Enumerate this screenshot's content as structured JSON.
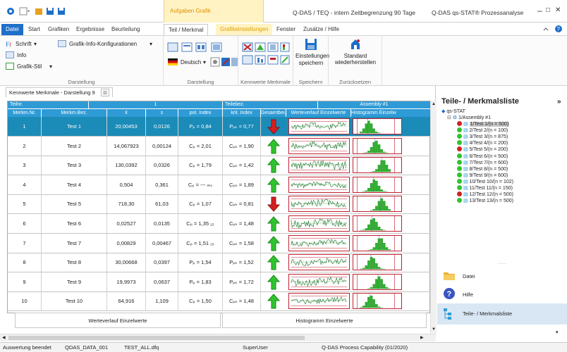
{
  "titlebar": {
    "context_label": "Aufgaben Grafik",
    "title_left": "Q-DAS / TEQ - intern Zeitbegrenzung 90 Tage",
    "title_right": "Q-DAS qs-STAT® Prozessanalyse",
    "min": "–",
    "max": "□",
    "close": "✕"
  },
  "tabs": [
    "Datei",
    "Start",
    "Grafiken",
    "Ergebnisse",
    "Beurteilung",
    "Teil / Merkmal",
    "Grafikeinstellungen",
    "Fenster",
    "Zusätze / Hilfe"
  ],
  "ribbon": {
    "schrift": "Schrift",
    "info": "Info",
    "grafikstil": "Grafik-Stil",
    "grafikinfo": "Grafik-Info-Konfigurationen",
    "darstellung1": "Darstellung",
    "deutsch": "Deutsch",
    "darstellung2": "Darstellung",
    "kennwerte": "Kennwerte Merkmale",
    "einstellungen": "Einstellungen",
    "speichern": "speichern",
    "speichern_grp": "Speichern",
    "standard": "Standard",
    "wiederherstellen": "wiederherstellen",
    "zuruck": "Zurücksetzen"
  },
  "doc": {
    "tab_label": "Kennwerte Merkmale - Darstellung 9",
    "header1": {
      "teilnr": "Teilnr.",
      "teilnr_val": "1",
      "teilebez": "Teilebez.",
      "teilebez_val": "Assembly #1"
    },
    "columns": [
      "Merkm.Nr.",
      "Merkm.Bez.",
      "x̄",
      "s",
      "pot. Index",
      "krit. Index",
      "Gesamtbeur",
      "Werteverlauf Einzelwerte",
      "Histogramm Einzelw"
    ],
    "rows": [
      {
        "nr": "1",
        "bez": "Test 1",
        "x": "20,00453",
        "s": "0,0126",
        "pot": "Pₚ  =  0,84",
        "krit": "Pₚₖ  =  0,77",
        "ok": false
      },
      {
        "nr": "2",
        "bez": "Test 2",
        "x": "14,067923",
        "s": "0,00124",
        "pot": "Cₚ  =  2,01",
        "krit": "Cₚₖ  =  1,90",
        "ok": true
      },
      {
        "nr": "3",
        "bez": "Test 3",
        "x": "130,0392",
        "s": "0,0326",
        "pot": "Cₚ  =  1,79",
        "krit": "Cₚₖ  =  1,42",
        "ok": true
      },
      {
        "nr": "4",
        "bez": "Test 4",
        "x": "0,504",
        "s": "0,361",
        "pot": "Cₚ  =  --- ₘₛ",
        "krit": "Cₚₖ  =  1,89",
        "ok": true
      },
      {
        "nr": "5",
        "bez": "Test 5",
        "x": "718,30",
        "s": "61,03",
        "pot": "Cₚ  =  1,07",
        "krit": "Cₚₖ  =  0,81",
        "ok": false
      },
      {
        "nr": "6",
        "bez": "Test 6",
        "x": "0,02527",
        "s": "0,0135",
        "pot": "Cₚ  = 1,35 ₁₅",
        "krit": "Cₚₖ  =  1,48",
        "ok": true
      },
      {
        "nr": "7",
        "bez": "Test 7",
        "x": "0,00829",
        "s": "0,00467",
        "pot": "Cₚ  = 1,51 ₁₅",
        "krit": "Cₚₖ  =  1,58",
        "ok": true
      },
      {
        "nr": "8",
        "bez": "Test 8",
        "x": "30,00668",
        "s": "0,0397",
        "pot": "Pₚ  =  1,54",
        "krit": "Pₚₖ  =  1,52",
        "ok": true
      },
      {
        "nr": "9",
        "bez": "Test 9",
        "x": "19,9973",
        "s": "0,0637",
        "pot": "Pₚ  =  1,83",
        "krit": "Pₚₖ  =  1,72",
        "ok": true
      },
      {
        "nr": "10",
        "bez": "Test 10",
        "x": "64,916",
        "s": "1,109",
        "pot": "Cₚ  =  1,50",
        "krit": "Cₚₖ  =  1,48",
        "ok": true
      }
    ],
    "footer_left": "Werteverlauf Einzelwerte",
    "footer_right": "Histogramm Einzelwerte"
  },
  "panel": {
    "title": "Teile- / Merkmalsliste",
    "root": "qs-STAT",
    "assembly": "1/Assembly #1",
    "items": [
      {
        "label": "1/Test 1/(n = 500)",
        "status": "red"
      },
      {
        "label": "2/Test 2/(n = 100)",
        "status": "green"
      },
      {
        "label": "3/Test 3/(n = 875)",
        "status": "green"
      },
      {
        "label": "4/Test 4/(n = 200)",
        "status": "green"
      },
      {
        "label": "5/Test 5/(n = 200)",
        "status": "red"
      },
      {
        "label": "6/Test 6/(n = 500)",
        "status": "green"
      },
      {
        "label": "7/Test 7/(n = 600)",
        "status": "green"
      },
      {
        "label": "8/Test 8/(n = 500)",
        "status": "green"
      },
      {
        "label": "9/Test 9/(n = 600)",
        "status": "green"
      },
      {
        "label": "10/Test 10/(n = 102)",
        "status": "green"
      },
      {
        "label": "11/Test 11/(n = 150)",
        "status": "green"
      },
      {
        "label": "12/Test 12/(n = 500)",
        "status": "red"
      },
      {
        "label": "13/Test 13/(n = 500)",
        "status": "green"
      }
    ],
    "nav": [
      "Datei",
      "Hilfe",
      "Teile- / Merkmalsliste"
    ]
  },
  "status": {
    "s1": "Auswertung beendet",
    "s2": "QDAS_DATA_001",
    "s3": "TEST_ALL.dfq",
    "s4": "SuperUser",
    "s5": "Q-DAS Process Capability (01/2020)"
  },
  "colors": {
    "accent": "#2f9bd6",
    "selected_row": "#1b8bb8",
    "ok": "#2fc42f",
    "nok": "#d42020"
  }
}
